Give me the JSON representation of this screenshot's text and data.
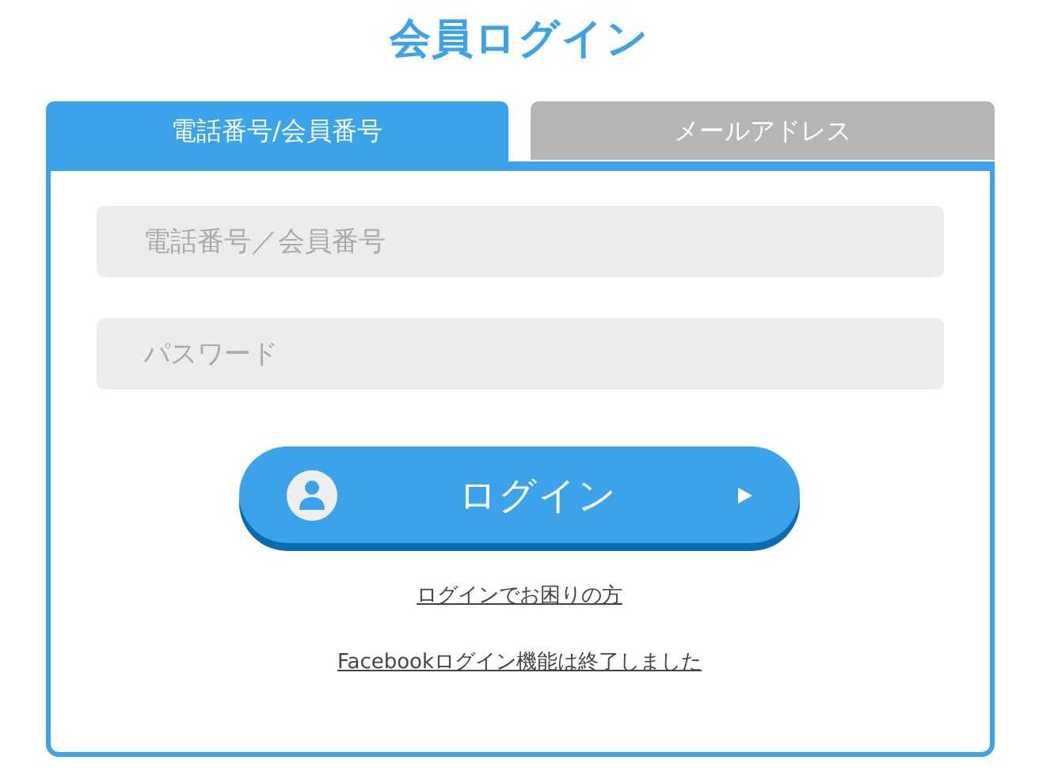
{
  "title": "会員ログイン",
  "tabs": [
    {
      "label": "電話番号/会員番号",
      "selected": true
    },
    {
      "label": "メールアドレス",
      "selected": false
    }
  ],
  "fields": [
    {
      "placeholder": "電話番号／会員番号"
    },
    {
      "placeholder": "パスワード"
    }
  ],
  "login_button": {
    "label": "ログイン"
  },
  "links": [
    "ログインでお困りの方",
    "Facebookログイン機能は終了しました"
  ]
}
